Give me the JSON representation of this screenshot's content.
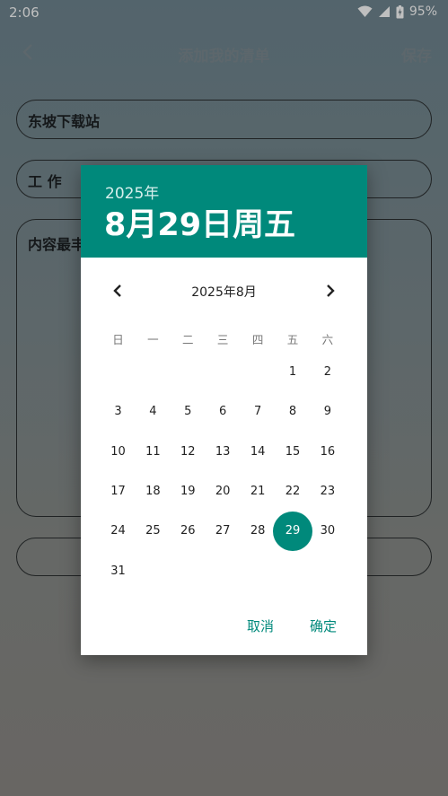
{
  "status_bar": {
    "time": "2:06",
    "battery_percent": "95%",
    "icons": [
      "wifi-icon",
      "signal-icon",
      "battery-charging-icon"
    ]
  },
  "app_bar": {
    "back_icon": "chevron-left-icon",
    "title": "添加我的清单",
    "save_label": "保存"
  },
  "form": {
    "name_value": "东坡下载站",
    "category_value": "工 作",
    "content_placeholder": "内容最丰"
  },
  "date_picker": {
    "header_year": "2025年",
    "header_date": "8月29日周五",
    "month_label": "2025年8月",
    "weekdays": [
      "日",
      "一",
      "二",
      "三",
      "四",
      "五",
      "六"
    ],
    "first_weekday_index": 5,
    "days_in_month": 31,
    "selected_day": 29,
    "cancel_label": "取消",
    "ok_label": "确定"
  },
  "colors": {
    "accent": "#00897b",
    "scrim": "rgba(0,0,0,0.25)"
  }
}
